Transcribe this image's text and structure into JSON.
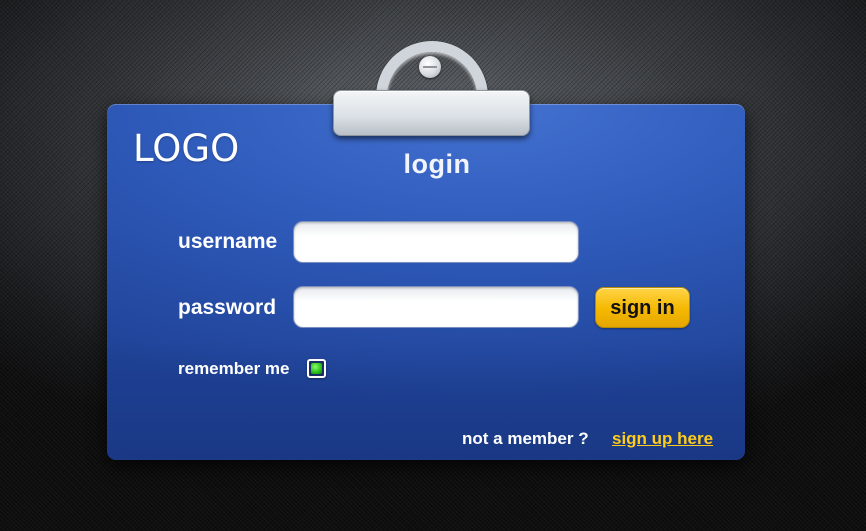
{
  "brand": {
    "logo_text": "LOGO"
  },
  "form": {
    "title": "login",
    "username_label": "username",
    "username_value": "",
    "password_label": "password",
    "password_value": "",
    "signin_label": "sign in",
    "remember_label": "remember me",
    "remember_checked": true
  },
  "footer": {
    "prompt": "not a member ?",
    "signup_link": "sign up here"
  },
  "colors": {
    "card": "#2f5bbb",
    "button": "#f5b800",
    "link": "#ffcc1a",
    "checkbox": "#2ec51f",
    "background": "#2a2c2f"
  },
  "icons": {
    "hanger": "hanger-clip-icon",
    "screw": "screw-icon",
    "checkbox": "checked-box-icon"
  }
}
